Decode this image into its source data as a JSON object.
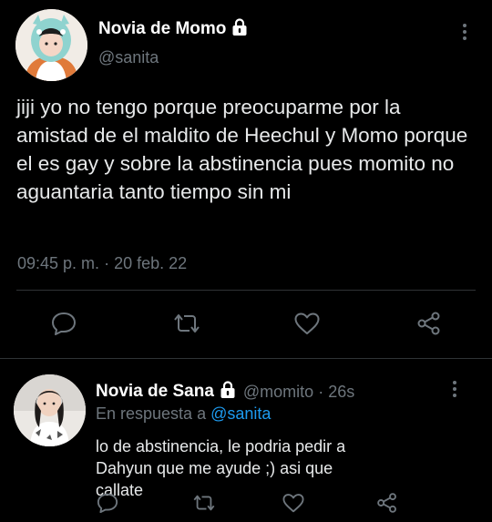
{
  "main_tweet": {
    "display_name": "Novia de Momo",
    "handle": "@sanita",
    "text": "jiji yo no tengo porque preocuparme por la amistad de el maldito de Heechul y Momo porque el es gay y sobre la abstinencia pues momito no aguantaria tanto tiempo sin mi",
    "time": "09:45 p. m.",
    "separator": "·",
    "date": "20 feb. 22",
    "protected_icon": "lock-icon",
    "actions": [
      "reply-icon",
      "retweet-icon",
      "like-icon",
      "share-icon"
    ]
  },
  "reply": {
    "display_name": "Novia de Sana",
    "handle": "@momito",
    "separator": "·",
    "age": "26s",
    "reply_prefix": "En respuesta a",
    "reply_to": "@sanita",
    "text": "lo de abstinencia, le podria pedir a Dahyun que me ayude ;) asi que callate",
    "protected_icon": "lock-icon",
    "actions": [
      "reply-icon",
      "retweet-icon",
      "like-icon",
      "share-icon"
    ]
  },
  "colors": {
    "background": "#000000",
    "text": "#e7e9ea",
    "muted": "#6e767d",
    "link": "#1d9bf0",
    "divider": "#2f3336"
  }
}
